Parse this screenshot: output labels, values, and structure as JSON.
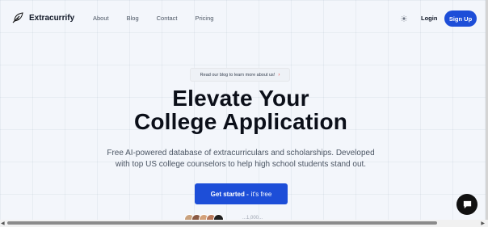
{
  "brand": {
    "name": "Extracurrify"
  },
  "nav": {
    "items": [
      {
        "label": "About"
      },
      {
        "label": "Blog"
      },
      {
        "label": "Contact"
      },
      {
        "label": "Pricing"
      }
    ],
    "login_label": "Login",
    "signup_label": "Sign Up"
  },
  "hero": {
    "announcement": "Read our blog to learn more about us!",
    "announcement_icon": "arrow-right-icon",
    "title_line1": "Elevate Your",
    "title_line2": "College Application",
    "subtitle_line1": "Free AI-powered database of extracurriculars and scholarships. Developed",
    "subtitle_line2": "with top US college counselors to help high school students stand out.",
    "cta_label": "Get started -",
    "cta_suffix": "it's free",
    "social_proof": "...1,000..."
  },
  "colors": {
    "accent": "#1d4ed8",
    "background": "#f3f6fb",
    "heading": "#0b0f19",
    "chat_bubble": "#111111"
  },
  "icons": {
    "logo": "feather-icon",
    "theme": "sun-icon",
    "chat": "chat-bubble-icon"
  }
}
